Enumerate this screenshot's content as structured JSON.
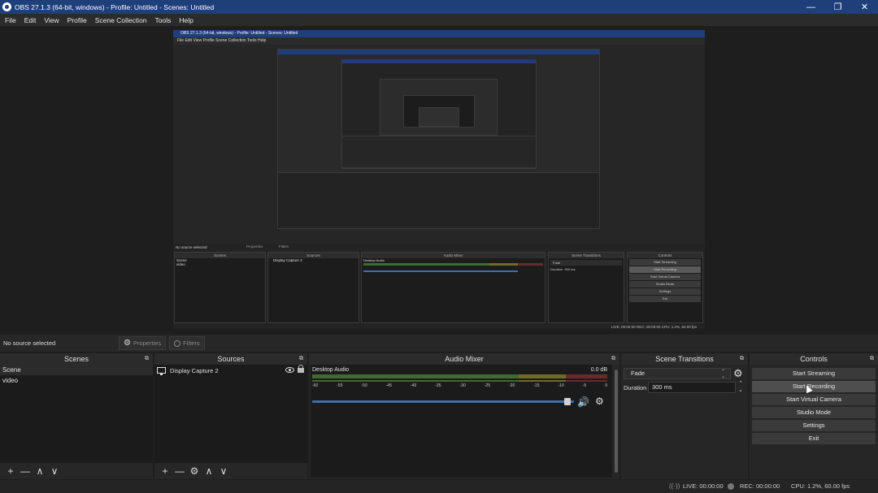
{
  "window": {
    "title": "OBS 27.1.3 (64-bit, windows) - Profile: Untitled - Scenes: Untitled",
    "minimize": "—",
    "restore": "❐",
    "close": "✕"
  },
  "menu": [
    "File",
    "Edit",
    "View",
    "Profile",
    "Scene Collection",
    "Tools",
    "Help"
  ],
  "preview": {
    "nested_title": "OBS 27.1.3 (64-bit, windows) - Profile: Untitled - Scenes: Untitled",
    "nested_menu": "File   Edit   View   Profile   Scene Collection   Tools   Help",
    "no_source": "No source selected",
    "properties": "Properties",
    "filters": "Filters",
    "scenes": "Scenes",
    "sources": "Sources",
    "mixer": "Audio Mixer",
    "transitions": "Scene Transitions",
    "controls": "Controls",
    "scene_items": [
      "Scene",
      "video"
    ],
    "source_item": "Display Capture 2",
    "desktop_audio": "Desktop Audio",
    "fade": "Fade",
    "duration_label": "Duration",
    "duration": "300 ms",
    "buttons": [
      "Start Streaming",
      "Start Recording",
      "Start Virtual Camera",
      "Studio Mode",
      "Settings",
      "Exit"
    ],
    "status": "LIVE: 00:00:00   REC: 00:00:00   CPU: 1.2%, 60.00 fps"
  },
  "source_toolbar": {
    "no_source": "No source selected",
    "properties": "Properties",
    "filters": "Filters"
  },
  "scenes": {
    "title": "Scenes",
    "items": [
      "Scene",
      "video"
    ],
    "selected": "Scene"
  },
  "sources": {
    "title": "Sources",
    "items": [
      {
        "name": "Display Capture 2",
        "visible": true,
        "locked": false
      }
    ]
  },
  "mixer": {
    "title": "Audio Mixer",
    "channel": "Desktop Audio",
    "db": "0.0 dB",
    "ticks": [
      "-60",
      "-55",
      "-50",
      "-45",
      "-40",
      "-35",
      "-30",
      "-25",
      "-20",
      "-15",
      "-10",
      "-5",
      "0"
    ]
  },
  "transitions": {
    "title": "Scene Transitions",
    "selected": "Fade",
    "duration_label": "Duration",
    "duration": "300 ms"
  },
  "controls": {
    "title": "Controls",
    "buttons": [
      "Start Streaming",
      "Start Recording",
      "Start Virtual Camera",
      "Studio Mode",
      "Settings",
      "Exit"
    ]
  },
  "status": {
    "live": "LIVE: 00:00:00",
    "rec": "REC: 00:00:00",
    "cpu": "CPU: 1.2%, 60.00 fps"
  },
  "icons": {
    "undock": "⧉",
    "add": "+",
    "remove": "—",
    "up": "∧",
    "down": "∨",
    "gear": "⚙",
    "volume": "🔊",
    "spin": "⌃⌄"
  }
}
